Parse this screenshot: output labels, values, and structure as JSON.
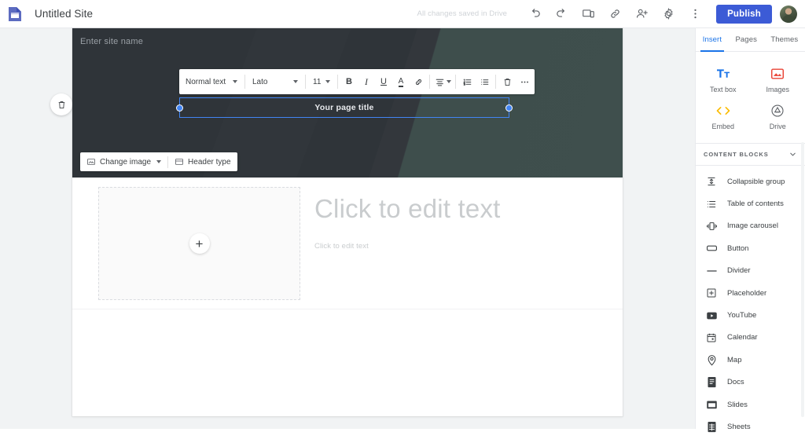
{
  "topbar": {
    "logo_icon": "google-sites-logo-icon",
    "site_title": "Untitled Site",
    "save_status": "All changes saved in Drive",
    "icons": [
      {
        "name": "undo-icon",
        "label": "Undo"
      },
      {
        "name": "redo-icon",
        "label": "Redo"
      },
      {
        "name": "preview-icon",
        "label": "Preview"
      },
      {
        "name": "copy-link-icon",
        "label": "Copy published site link"
      },
      {
        "name": "share-icon",
        "label": "Share with others"
      },
      {
        "name": "settings-gear-icon",
        "label": "Settings"
      },
      {
        "name": "more-vert-icon",
        "label": "More options"
      }
    ],
    "publish_label": "Publish",
    "avatar_name": "user-avatar"
  },
  "canvas": {
    "banner": {
      "site_name_placeholder": "Enter site name",
      "page_title": "Your page title",
      "change_image_label": "Change image",
      "header_type_label": "Header type",
      "bg_left_color": "#2f3439",
      "bg_right_color": "#3c4c4a",
      "selection_color": "#4285f4"
    },
    "text_toolbar": {
      "style_value": "Normal text",
      "font_value": "Lato",
      "size_value": "11",
      "buttons": [
        {
          "name": "bold-button",
          "glyph": "B"
        },
        {
          "name": "italic-button",
          "glyph": "I"
        },
        {
          "name": "underline-button",
          "glyph": "U"
        },
        {
          "name": "text-color-button",
          "glyph": "A"
        },
        {
          "name": "link-button",
          "glyph": "link-icon"
        },
        {
          "name": "align-button",
          "glyph": "align-icon"
        },
        {
          "name": "numbered-list-button",
          "glyph": "numbered-list-icon"
        },
        {
          "name": "bulleted-list-button",
          "glyph": "bulleted-list-icon"
        },
        {
          "name": "delete-button",
          "glyph": "trash-icon"
        },
        {
          "name": "more-options-button",
          "glyph": "ellipsis-icon"
        }
      ]
    },
    "body": {
      "image_placeholder_action": "+",
      "heading_placeholder": "Click to edit text",
      "text_placeholder": "Click to edit text"
    },
    "delete_section_icon": "trash-icon"
  },
  "panel": {
    "tabs": [
      {
        "label": "Insert",
        "active": true
      },
      {
        "label": "Pages",
        "active": false
      },
      {
        "label": "Themes",
        "active": false
      }
    ],
    "insert_items": [
      {
        "label": "Text box",
        "icon": "text-box-icon",
        "color": "#1a73e8"
      },
      {
        "label": "Images",
        "icon": "images-icon",
        "color": "#ea4335"
      },
      {
        "label": "Embed",
        "icon": "embed-code-icon",
        "color": "#fbbc04"
      },
      {
        "label": "Drive",
        "icon": "google-drive-icon",
        "color": "#5f6368"
      }
    ],
    "content_blocks_title": "CONTENT BLOCKS",
    "content_blocks_chevron": "chevron-down-icon",
    "content_blocks": [
      {
        "label": "Collapsible group",
        "icon": "collapsible-group-icon"
      },
      {
        "label": "Table of contents",
        "icon": "table-of-contents-icon"
      },
      {
        "label": "Image carousel",
        "icon": "image-carousel-icon"
      },
      {
        "label": "Button",
        "icon": "button-icon"
      },
      {
        "label": "Divider",
        "icon": "divider-icon"
      },
      {
        "label": "Placeholder",
        "icon": "placeholder-icon"
      },
      {
        "label": "YouTube",
        "icon": "youtube-icon"
      },
      {
        "label": "Calendar",
        "icon": "calendar-icon"
      },
      {
        "label": "Map",
        "icon": "map-pin-icon"
      },
      {
        "label": "Docs",
        "icon": "google-docs-icon"
      },
      {
        "label": "Slides",
        "icon": "google-slides-icon"
      },
      {
        "label": "Sheets",
        "icon": "google-sheets-icon"
      }
    ]
  }
}
